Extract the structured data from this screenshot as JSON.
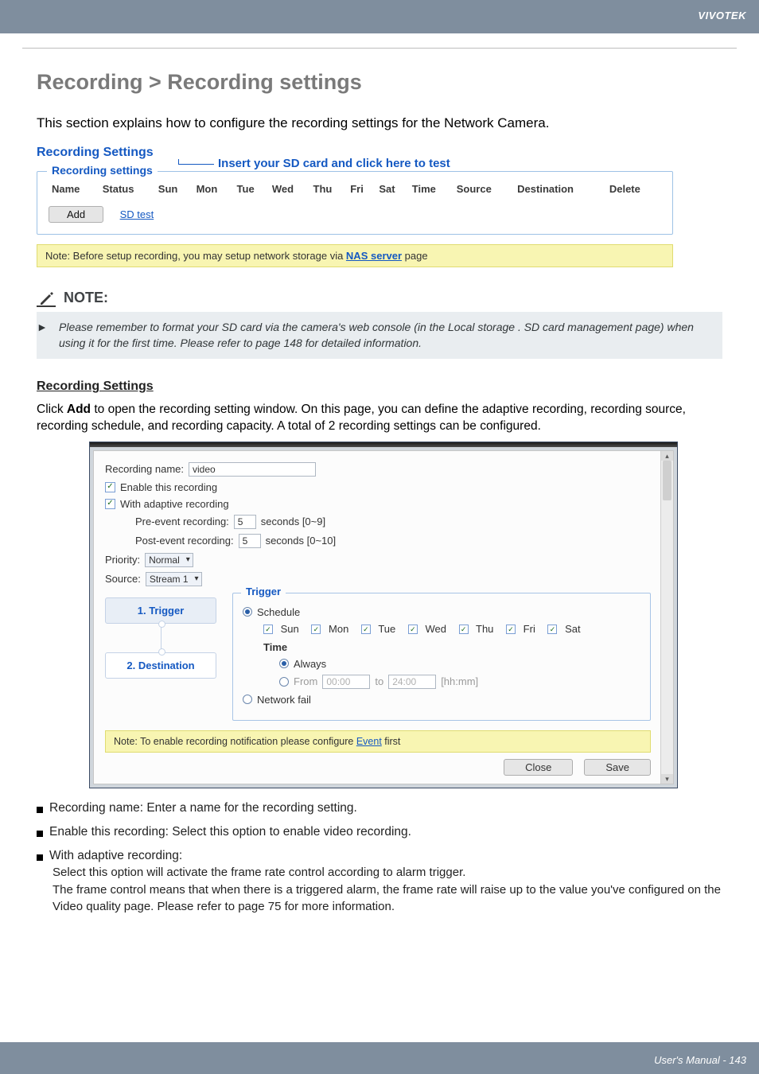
{
  "brand": "VIVOTEK",
  "footer": "User's Manual - 143",
  "h1": "Recording > Recording settings",
  "intro": "This section explains how to configure the recording settings for the Network Camera.",
  "rs": {
    "heading": "Recording Settings",
    "insert_hint": "Insert your SD card and click here to test",
    "legend": "Recording settings",
    "cols": [
      "Name",
      "Status",
      "Sun",
      "Mon",
      "Tue",
      "Wed",
      "Thu",
      "Fri",
      "Sat",
      "Time",
      "Source",
      "Destination",
      "Delete"
    ],
    "add_btn": "Add",
    "sd_test": "SD test",
    "note_prefix": "Note: Before setup recording, you may setup network storage via ",
    "note_link": "NAS server",
    "note_suffix": " page"
  },
  "note_box": {
    "title": "NOTE:",
    "body": "Please remember to format your SD card via the camera's web console (in the Local storage . SD card management page) when using it for the first time. Please refer to page 148 for detailed information."
  },
  "rs2": {
    "heading": "Recording Settings",
    "para": "Click Add to open the recording setting window. On this page, you can define the adaptive recording, recording source, recording schedule, and recording capacity. A total of 2 recording settings can be configured."
  },
  "dlg": {
    "rec_name_label": "Recording name:",
    "rec_name_value": "video",
    "enable": "Enable this recording",
    "adaptive": "With adaptive recording",
    "pre_label": "Pre-event recording:",
    "pre_value": "5",
    "pre_hint": "seconds [0~9]",
    "post_label": "Post-event recording:",
    "post_value": "5",
    "post_hint": "seconds [0~10]",
    "priority_label": "Priority:",
    "priority_value": "Normal",
    "source_label": "Source:",
    "source_value": "Stream 1",
    "step1": "1. Trigger",
    "step2": "2. Destination",
    "trigger_legend": "Trigger",
    "schedule": "Schedule",
    "days": [
      "Sun",
      "Mon",
      "Tue",
      "Wed",
      "Thu",
      "Fri",
      "Sat"
    ],
    "time_label": "Time",
    "always": "Always",
    "from": "From",
    "from_val": "00:00",
    "to": "to",
    "to_val": "24:00",
    "hhmm": "[hh:mm]",
    "netfail": "Network fail",
    "note2_prefix": "Note: To enable recording notification please configure ",
    "note2_link": "Event",
    "note2_suffix": " first",
    "close": "Close",
    "save": "Save"
  },
  "bullets": {
    "b1": "Recording name: Enter a name for the recording setting.",
    "b2": "Enable this recording: Select this option to enable video recording.",
    "b3": "With adaptive recording:",
    "b3a": "Select this option will activate the frame rate control according to alarm trigger.",
    "b3b": "The frame control means that when there is a triggered alarm, the frame rate will raise up to the value you've configured on the Video quality page. Please refer to page 75 for more information."
  }
}
